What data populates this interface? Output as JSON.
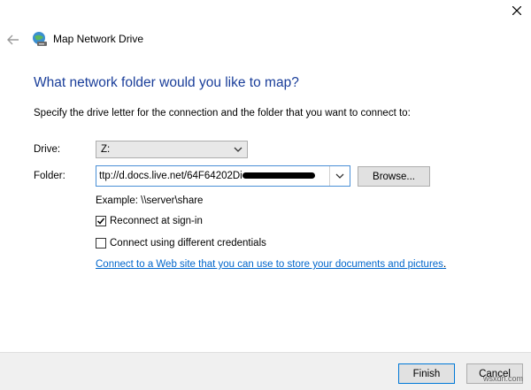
{
  "window": {
    "title": "Map Network Drive"
  },
  "main": {
    "heading": "What network folder would you like to map?",
    "instructions": "Specify the drive letter for the connection and the folder that you want to connect to:",
    "drive": {
      "label": "Drive:",
      "value": "Z:"
    },
    "folder": {
      "label": "Folder:",
      "value": "ttp://d.docs.live.net/64F64202Di"
    },
    "browse_label": "Browse...",
    "example": "Example: \\\\server\\share",
    "reconnect": {
      "label": "Reconnect at sign-in",
      "checked": true
    },
    "credentials": {
      "label": "Connect using different credentials",
      "checked": false
    },
    "link_text": "Connect to a Web site that you can use to store your documents and pictures",
    "link_suffix": "."
  },
  "footer": {
    "finish_label": "Finish",
    "cancel_label": "Cancel"
  },
  "watermark": "wsxdn.com",
  "colors": {
    "heading": "#1a3e9a",
    "link": "#0066cc",
    "focus": "#0078d7"
  },
  "icons": [
    "close-icon",
    "back-arrow-icon",
    "network-drive-icon",
    "chevron-down-icon",
    "checkmark-icon"
  ]
}
